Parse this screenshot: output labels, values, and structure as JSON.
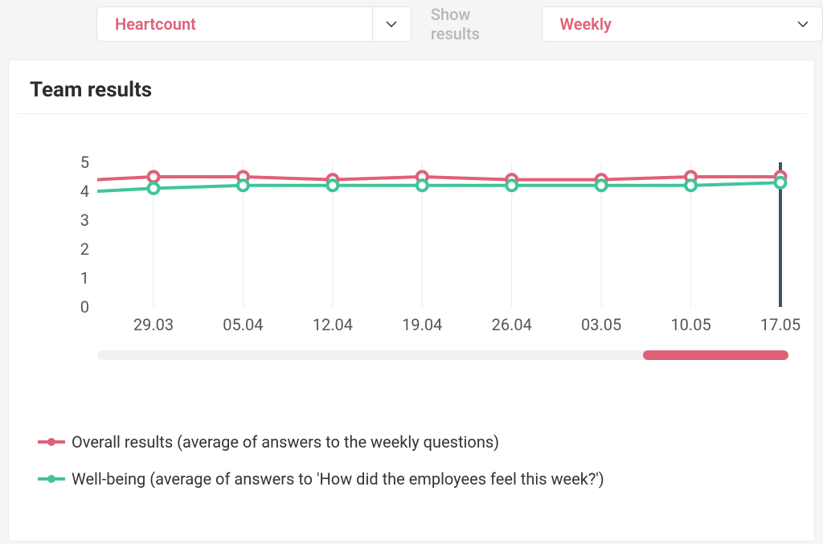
{
  "filters": {
    "team_select": "Heartcount",
    "label": "Show results",
    "period_select": "Weekly"
  },
  "card": {
    "title": "Team results"
  },
  "legend": {
    "overall": "Overall results (average of answers to the weekly questions)",
    "wellbeing": "Well-being (average of answers to 'How did the employees feel this week?')"
  },
  "colors": {
    "overall": "#e06078",
    "wellbeing": "#41c49b"
  },
  "chart_data": {
    "type": "line",
    "title": "Team results",
    "xlabel": "",
    "ylabel": "",
    "ylim": [
      0,
      5
    ],
    "yticks": [
      0,
      1,
      2,
      3,
      4,
      5
    ],
    "categories": [
      "29.03",
      "05.04",
      "12.04",
      "19.04",
      "26.04",
      "03.05",
      "10.05",
      "17.05"
    ],
    "series": [
      {
        "name": "Overall results (average of answers to the weekly questions)",
        "color": "#e06078",
        "values": [
          4.5,
          4.5,
          4.4,
          4.5,
          4.4,
          4.4,
          4.5,
          4.5
        ]
      },
      {
        "name": "Well-being (average of answers to 'How did the employees feel this week?')",
        "color": "#41c49b",
        "values": [
          4.1,
          4.2,
          4.2,
          4.2,
          4.2,
          4.2,
          4.2,
          4.3
        ]
      }
    ],
    "cursor_at_index": 7,
    "left_entry": {
      "overall": 4.4,
      "wellbeing": 4.0
    }
  },
  "scroll": {
    "thumb_start_pct": 79,
    "thumb_width_pct": 21
  }
}
